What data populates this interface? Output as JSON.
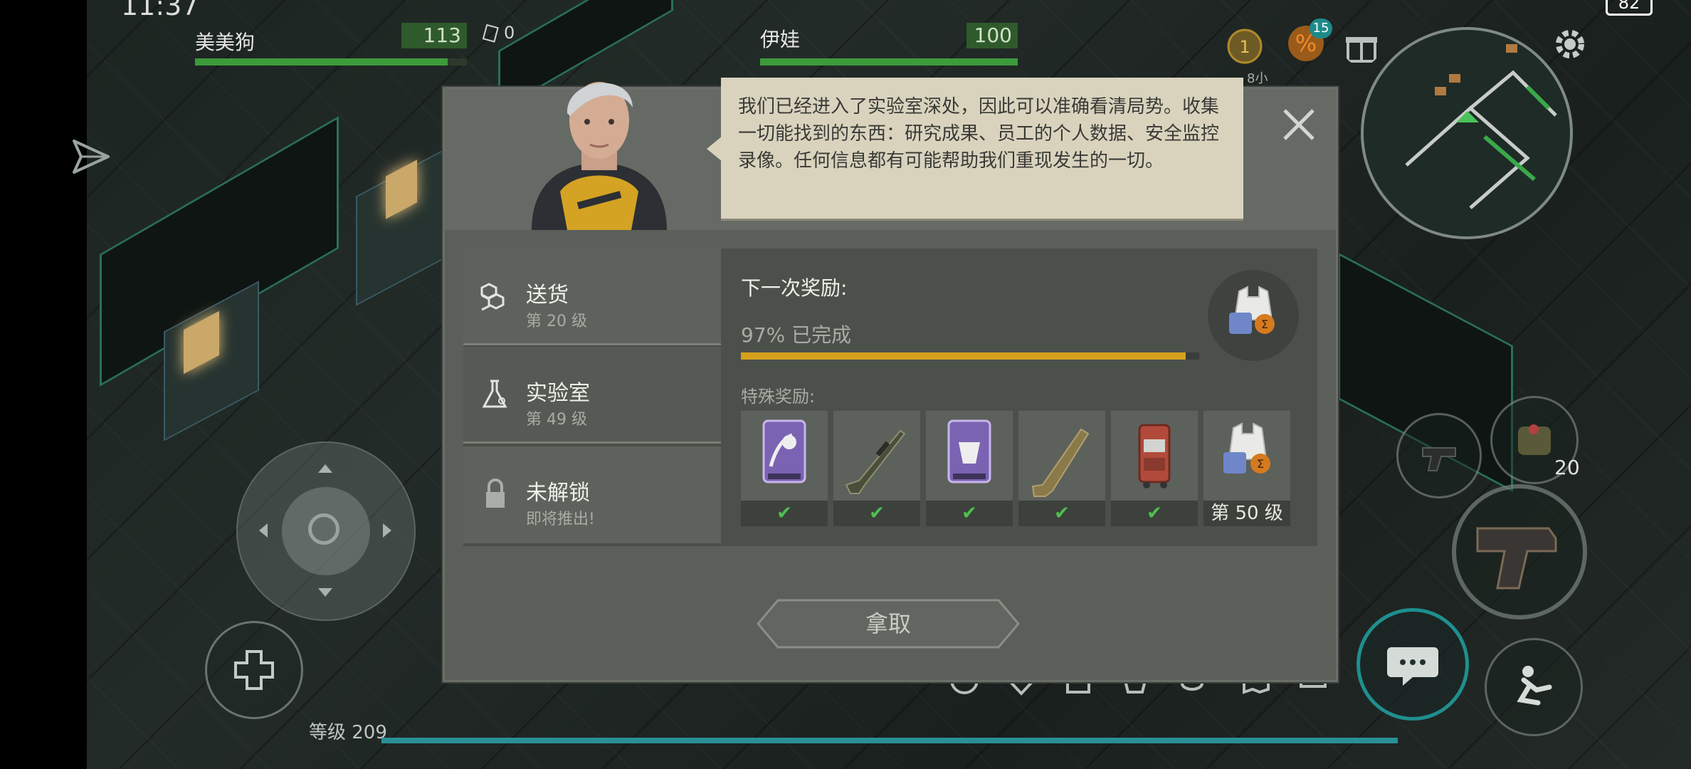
{
  "status_bar": {
    "time": "11:37",
    "battery": "82"
  },
  "party": [
    {
      "name": "美美狗",
      "hp": "113",
      "hp_fraction": 0.93
    },
    {
      "name": "伊娃",
      "hp": "100",
      "hp_fraction": 1.0
    }
  ],
  "currency": {
    "count": "0"
  },
  "top_right": {
    "timer_label": "8小",
    "discount_badge": "15"
  },
  "dialog": {
    "speech": "我们已经进入了实验室深处，因此可以准确看清局势。收集一切能找到的东西：研究成果、员工的个人数据、安全监控录像。任何信息都有可能帮助我们重现发生的一切。",
    "tabs": [
      {
        "name": "送货",
        "sub": "第 20 级",
        "icon": "boxes-icon"
      },
      {
        "name": "实验室",
        "sub": "第 49 级",
        "icon": "flask-icon"
      },
      {
        "name": "未解锁",
        "sub": "即将推出!",
        "icon": "lock-icon"
      }
    ],
    "next_reward_title": "下一次奖励:",
    "progress_text": "97% 已完成",
    "progress_value": 0.97,
    "special_rewards_title": "特殊奖励:",
    "rewards": [
      {
        "icon": "skull-card-icon",
        "status": "✔"
      },
      {
        "icon": "sniper-rifle-icon",
        "status": "✔"
      },
      {
        "icon": "blueprint-card-icon",
        "status": "✔"
      },
      {
        "icon": "shotgun-icon",
        "status": "✔"
      },
      {
        "icon": "backpack-red-icon",
        "status": "✔"
      },
      {
        "icon": "armor-vest-icon",
        "status": "第 50 级"
      }
    ],
    "claim_label": "拿取"
  },
  "hud": {
    "level_label": "等级 209",
    "ammo_count": "20"
  },
  "colors": {
    "progress": "#d6a21e",
    "hp_green": "#3c9b3a",
    "xp_teal": "#2b8f96",
    "speech_bg": "#d9d3be"
  }
}
